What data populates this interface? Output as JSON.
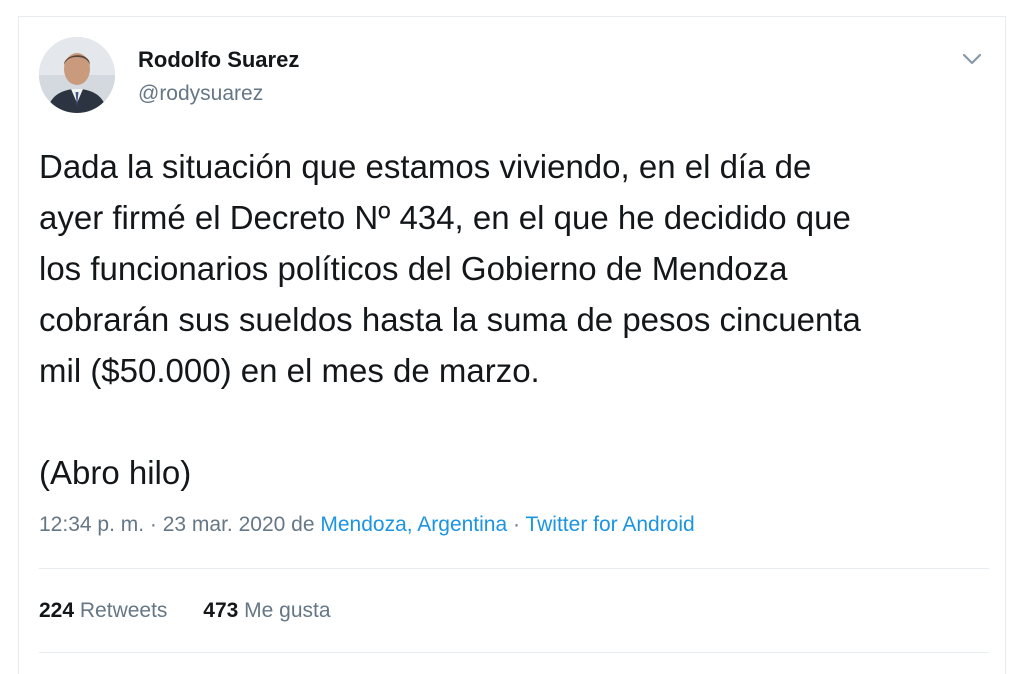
{
  "tweet": {
    "author_name": "Rodolfo Suarez",
    "author_handle": "@rodysuarez",
    "text": "Dada la situación que estamos viviendo, en el día de\nayer firmé el Decreto Nº 434, en el que he decidido que\nlos funcionarios políticos del Gobierno de Mendoza\ncobrarán sus sueldos hasta la suma de pesos cincuenta\nmil ($50.000) en el mes de marzo.\n\n(Abro hilo)",
    "timestamp": "12:34 p. m. · 23 mar. 2020",
    "from_word": "de",
    "location": "Mendoza, Argentina",
    "separator": "·",
    "source": "Twitter for Android"
  },
  "stats": {
    "retweets_count": "224",
    "retweets_label": "Retweets",
    "likes_count": "473",
    "likes_label": "Me gusta"
  },
  "icons": {
    "caret": "chevron-down-icon"
  },
  "colors": {
    "link": "#1b95e0",
    "secondary_text": "#657786",
    "primary_text": "#14171a",
    "border": "#e6ecf0"
  }
}
